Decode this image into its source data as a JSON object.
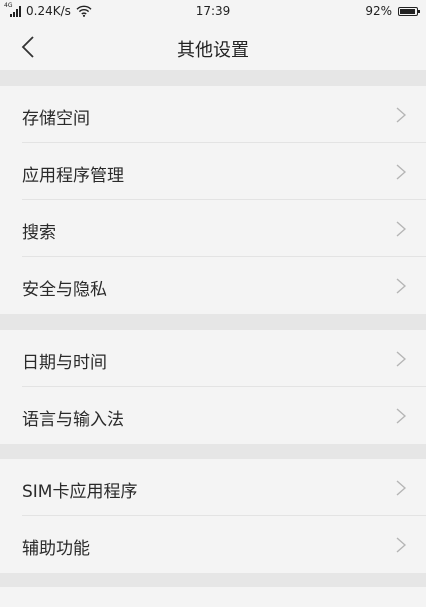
{
  "status_bar": {
    "network_type": "4G",
    "speed": "0.24K/s",
    "time": "17:39",
    "battery": "92%",
    "battery_level": 0.92
  },
  "nav": {
    "title": "其他设置",
    "back_icon": "chevron-left-icon"
  },
  "groups": [
    {
      "items": [
        {
          "label": "存储空间"
        },
        {
          "label": "应用程序管理"
        },
        {
          "label": "搜索"
        },
        {
          "label": "安全与隐私"
        }
      ]
    },
    {
      "items": [
        {
          "label": "日期与时间"
        },
        {
          "label": "语言与输入法"
        }
      ]
    },
    {
      "items": [
        {
          "label": "SIM卡应用程序"
        },
        {
          "label": "辅助功能"
        }
      ]
    }
  ],
  "colors": {
    "background": "#f4f4f4",
    "separator": "#e6e6e6",
    "text": "#2a2a2a",
    "chevron": "#b5b5b5"
  }
}
